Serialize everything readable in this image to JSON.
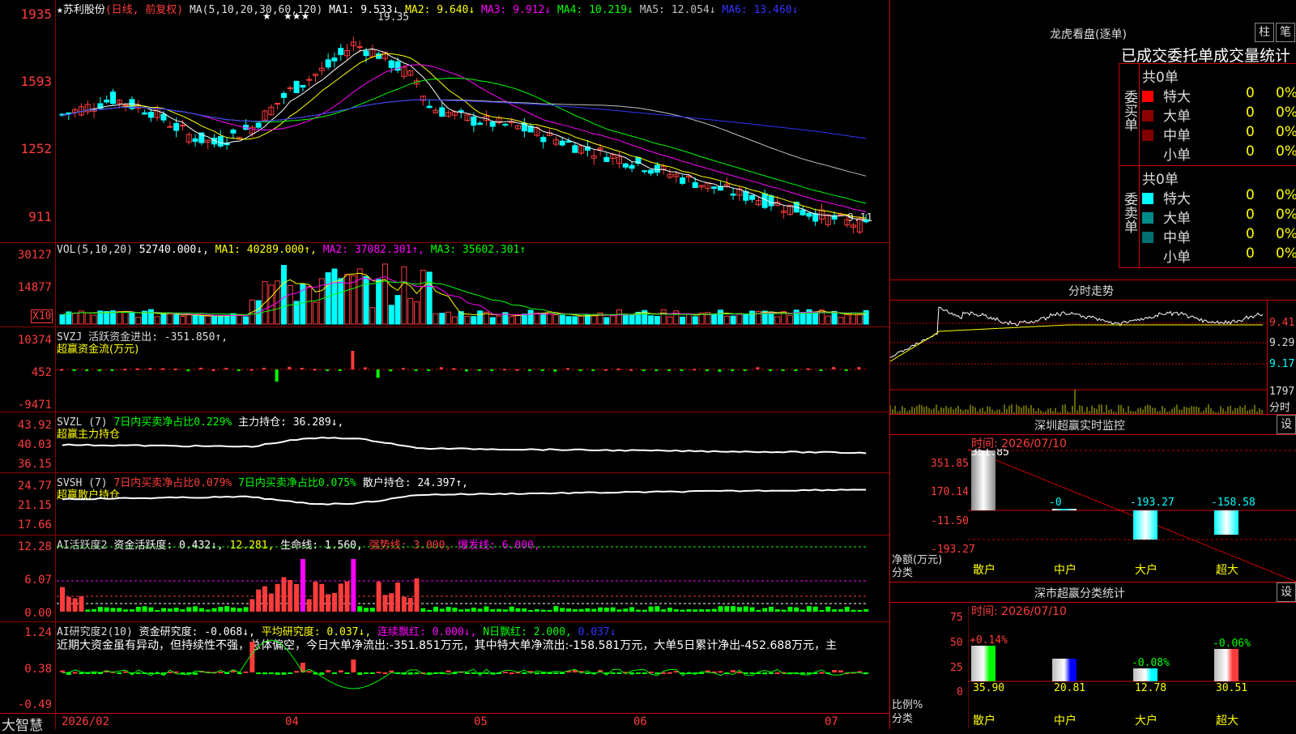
{
  "stock": {
    "name_label": "★苏利股份",
    "period_label": "(日线, 前复权)"
  },
  "price_panel": {
    "ma_prefix": "MA(5,10,20,30,60,120)",
    "ma": [
      {
        "label": "MA1: 9.533↓",
        "color": "#ffffff"
      },
      {
        "label": "MA2: 9.640↓",
        "color": "#ffff00"
      },
      {
        "label": "MA3: 9.912↓",
        "color": "#ff00ff"
      },
      {
        "label": "MA4: 10.219↓",
        "color": "#00ff00"
      },
      {
        "label": "MA5: 12.054↓",
        "color": "#c0c0c0"
      },
      {
        "label": "MA6: 13.460↓",
        "color": "#3333ff"
      }
    ],
    "y_ticks": [
      "1935",
      "1593",
      "1252",
      "911"
    ],
    "high_label": "19.35",
    "low_label": "9.11",
    "stars": "★    ★★★"
  },
  "vol_panel": {
    "header": "VOL(5,10,20)",
    "value": "52740.000↓,",
    "ma": [
      {
        "label": "MA1: 40289.000↑,",
        "color": "#ffff00"
      },
      {
        "label": "MA2: 37082.301↑,",
        "color": "#ff00ff"
      },
      {
        "label": "MA3: 35602.301↑",
        "color": "#00ff00"
      }
    ],
    "y_ticks": [
      "30127",
      "14877"
    ],
    "unit": "X10"
  },
  "svzj_panel": {
    "header": "SVZJ  活跃资金进出: -351.850↑,",
    "sub": "超赢资金流(万元)",
    "y_ticks": [
      "10374",
      "452",
      "-9471"
    ]
  },
  "svzl_panel": {
    "header_a": "SVZL (7)",
    "header_b": "7日内买卖净占比0.229%",
    "header_c": "主力持仓: 36.289↓,",
    "sub": "超赢主力持仓",
    "y_ticks": [
      "43.92",
      "40.03",
      "36.15"
    ]
  },
  "svsh_panel": {
    "header_a": "SVSH (7)",
    "header_b": "7日内买卖净占比0.079%",
    "header_c": "7日内买卖净占比0.075%",
    "header_d": "散户持仓: 24.397↑,",
    "sub": "超赢散户持仓",
    "y_ticks": [
      "24.77",
      "21.15",
      "17.66"
    ]
  },
  "ai_active_panel": {
    "header_a": "AI活跃度2",
    "header_b": "资金活跃度: 0.432↓,",
    "header_c": "12.281,",
    "header_d": "生命线: 1.560,",
    "header_e": "强势线: 3.000,",
    "header_f": "爆发线: 6.000,",
    "y_ticks": [
      "12.28",
      "6.07",
      "0.00"
    ]
  },
  "ai_research_panel": {
    "header_a": "AI研究度2(10)",
    "header_b": "资金研究度: -0.068↓,",
    "header_c": "平均研究度: 0.037↓,",
    "header_d": "连续飘红: 0.000↓,",
    "header_e": "N日飘红: 2.000,",
    "header_f": "0.037↓",
    "comment": "近期大资金虽有异动，但持续性不强，总体偏空，今日大单净流出:-351.851万元，其中特大单净流出:-158.581万元，大单5日累计净出-452.688万元，主",
    "y_ticks": [
      "1.24",
      "0.38",
      "-0.49"
    ]
  },
  "x_axis": {
    "labels": [
      "2026/02",
      "04",
      "05",
      "06",
      "07"
    ]
  },
  "brand": "大智慧",
  "longhu": {
    "title": "龙虎看盘(逐单)",
    "btn_bar": "柱",
    "btn_pen": "笔",
    "stat_title": "已成交委托单成交量统计",
    "buy_side_label": "委买单",
    "sell_side_label": "委卖单",
    "buy_total": "共0单",
    "sell_total": "共0单",
    "rows": [
      {
        "label": "特大",
        "count": "0",
        "pct": "0%"
      },
      {
        "label": "大单",
        "count": "0",
        "pct": "0%"
      },
      {
        "label": "中单",
        "count": "0",
        "pct": "0%"
      },
      {
        "label": "小单",
        "count": "0",
        "pct": "0%"
      }
    ],
    "buy_colors": [
      "#ff0000",
      "#8b0000",
      "#800000",
      "#000000"
    ],
    "sell_colors": [
      "#00ffff",
      "#008b8b",
      "#007070",
      "#000000"
    ]
  },
  "intraday": {
    "title": "分时走势",
    "y_ticks": [
      "9.41",
      "9.29",
      "9.17"
    ],
    "vol_tick": "1797",
    "vol_label": "分时"
  },
  "sz_monitor": {
    "title": "深圳超赢实时监控",
    "btn": "设",
    "time": "时间: 2026/07/10",
    "y_ticks": [
      "351.85",
      "170.14",
      "-11.50",
      "-193.27"
    ],
    "unit": "净额(万元)",
    "cat_label": "分类",
    "bars": [
      {
        "label": "散户",
        "value": "351.85"
      },
      {
        "label": "中户",
        "value": "-0"
      },
      {
        "label": "大户",
        "value": "-193.27"
      },
      {
        "label": "超大",
        "value": "-158.58"
      }
    ]
  },
  "sz_classify": {
    "title": "深市超赢分类统计",
    "btn": "设",
    "time": "时间: 2026/07/10",
    "y_ticks": [
      "75",
      "50",
      "25",
      "0"
    ],
    "unit": "比例%",
    "cat_label": "分类",
    "bars": [
      {
        "label": "散户",
        "value": "35.90",
        "change": "+0.14%"
      },
      {
        "label": "中户",
        "value": "20.81",
        "change": ""
      },
      {
        "label": "大户",
        "value": "12.78",
        "change": "-0.08%"
      },
      {
        "label": "超大",
        "value": "30.51",
        "change": "-0.06%"
      }
    ]
  }
}
